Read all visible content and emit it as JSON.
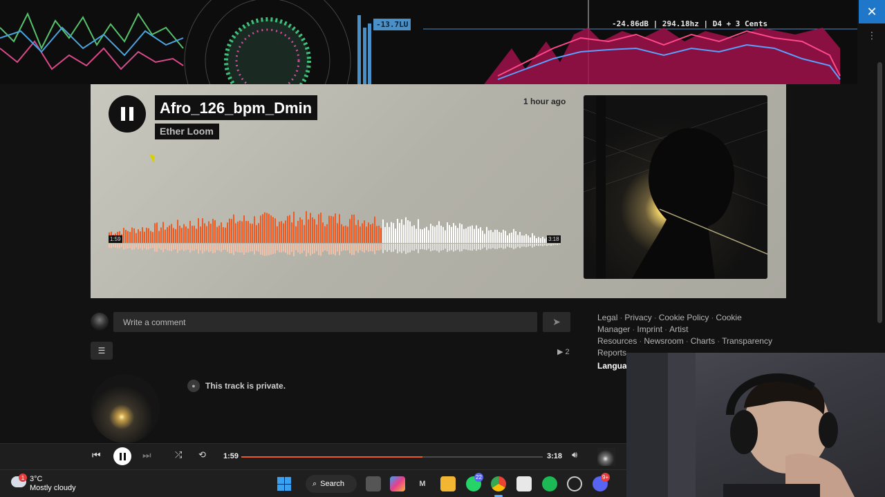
{
  "analyzer": {
    "loudness": "-13.7LU",
    "readout": "-24.86dB | 294.18hz | D4 + 3 Cents"
  },
  "track": {
    "title": "Afro_126_bpm_Dmin",
    "artist": "Ether Loom",
    "posted": "1 hour ago",
    "elapsed": "1:59",
    "duration": "3:18",
    "progress_fraction": 0.601,
    "plays": "2",
    "private_notice": "This track is private."
  },
  "comment": {
    "placeholder": "Write a comment"
  },
  "footer": {
    "links": [
      "Legal",
      "Privacy",
      "Cookie Policy",
      "Cookie Manager",
      "Imprint",
      "Artist Resources",
      "Newsroom",
      "Charts",
      "Transparency Reports"
    ],
    "language_label": "Languag"
  },
  "player": {
    "elapsed": "1:59",
    "duration": "3:18"
  },
  "taskbar": {
    "temperature": "3°C",
    "condition": "Mostly cloudy",
    "weather_badge": "1",
    "search_label": "Search",
    "whatsapp_badge": "22",
    "discord_badge": "9+"
  },
  "window": {
    "close_glyph": "✕",
    "more_glyph": "⋮"
  },
  "colors": {
    "accent": "#f05a22",
    "played_wave": "#f05a22",
    "unplayed_wave": "#ffffff"
  },
  "icons": {
    "play_pause": "pause-icon",
    "send": "send-icon",
    "filter": "filter-icon",
    "lock": "lock-icon",
    "previous": "skip-previous-icon",
    "next": "skip-next-icon",
    "shuffle": "shuffle-icon",
    "repeat": "repeat-icon",
    "volume": "volume-icon"
  }
}
